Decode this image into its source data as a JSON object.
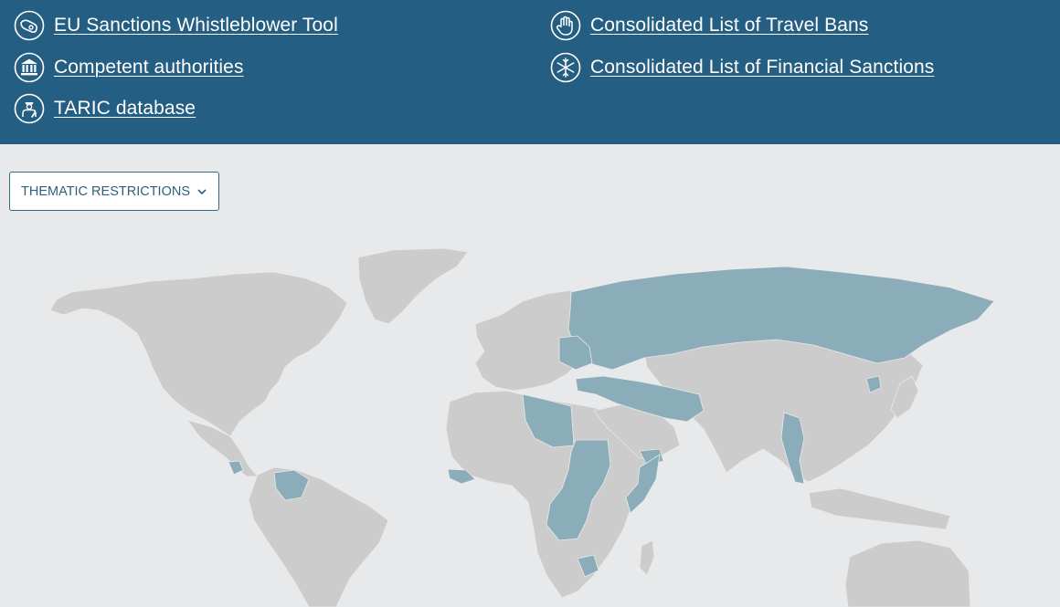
{
  "links": [
    {
      "id": "whistleblower",
      "label": "EU Sanctions Whistleblower Tool",
      "icon": "whistle-icon"
    },
    {
      "id": "travel-bans",
      "label": "Consolidated List of Travel Bans",
      "icon": "hand-icon"
    },
    {
      "id": "authorities",
      "label": "Competent authorities",
      "icon": "institution-icon"
    },
    {
      "id": "financial-sanctions",
      "label": "Consolidated List of Financial Sanctions",
      "icon": "snowflake-icon"
    },
    {
      "id": "taric",
      "label": "TARIC database",
      "icon": "customs-officer-icon"
    }
  ],
  "filter": {
    "label": "THEMATIC RESTRICTIONS",
    "icon": "chevron-down-icon"
  },
  "colors": {
    "header_bg": "#245e82",
    "page_bg": "#e8e9ea",
    "land": "#cccccc",
    "sanctioned": "#8bacb9",
    "link_text": "#ffffff",
    "dropdown_text": "#2f5f7c"
  }
}
